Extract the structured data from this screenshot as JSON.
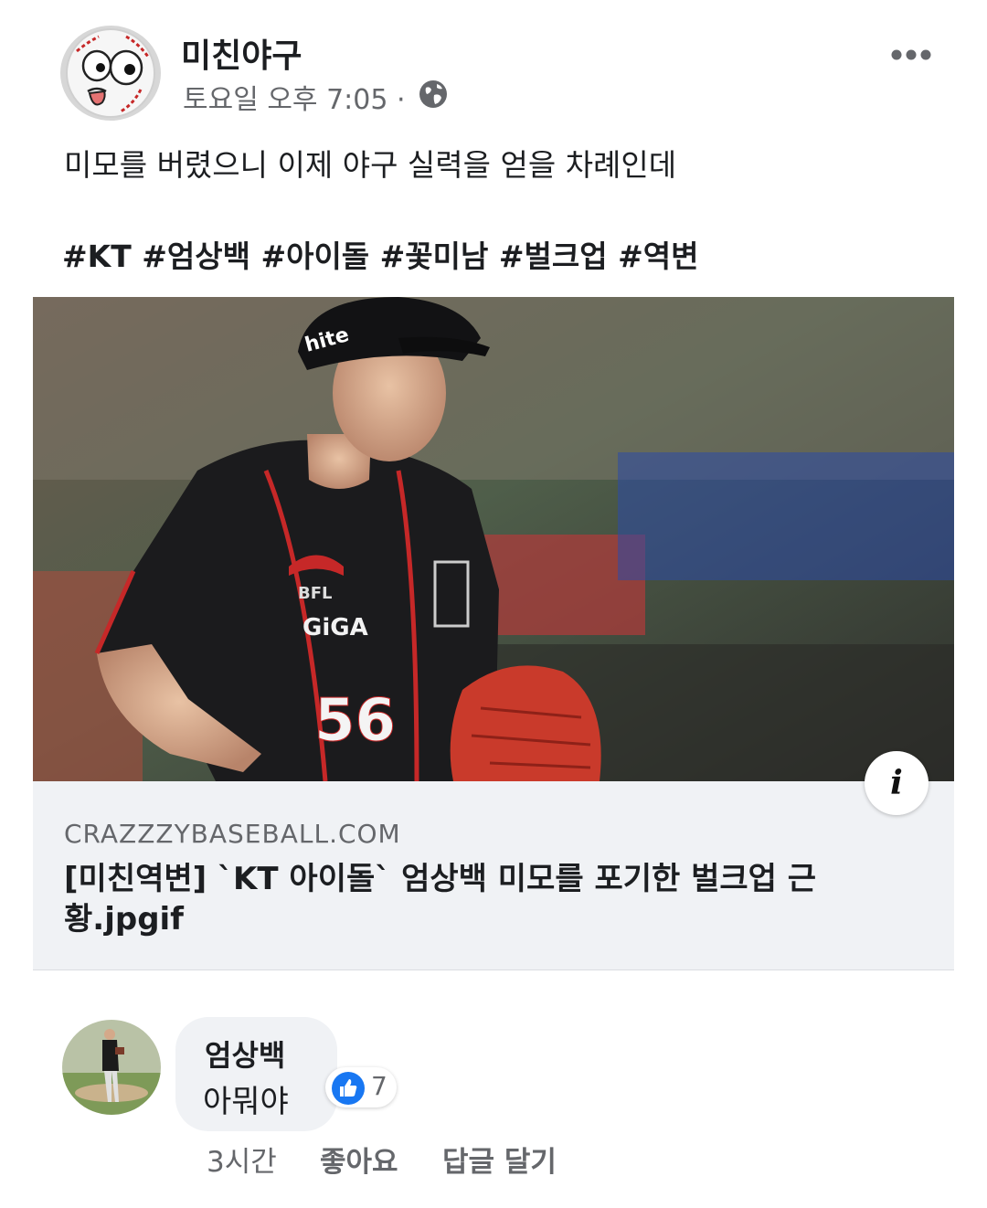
{
  "post": {
    "page_name": "미친야구",
    "timestamp": "토요일 오후 7:05 ·",
    "caption": "미모를 버렸으니 이제 야구 실력을 얻을 차례인데",
    "hashtags": "#KT #엄상백 #아이돌 #꽃미남 #벌크업 #역변",
    "privacy_icon": "globe-icon",
    "more_icon": "more-options-icon"
  },
  "link_preview": {
    "cap_logo": "hite",
    "jersey_sponsor": "GiGA",
    "jersey_patch": "BFL",
    "jersey_number": "56",
    "domain": "CRAZZZYBASEBALL.COM",
    "title": "[미친역변] `KT 아이돌` 엄상백 미모를 포기한 벌크업 근황.jpgif",
    "info_icon": "i"
  },
  "comment": {
    "author": "엄상백",
    "text": "아뭐야",
    "reaction_count": "7",
    "time": "3시간",
    "like_label": "좋아요",
    "reply_label": "답글 달기"
  },
  "colors": {
    "secondary_text": "#65676b",
    "card_background": "#f0f2f5",
    "like_blue": "#1877f2"
  }
}
